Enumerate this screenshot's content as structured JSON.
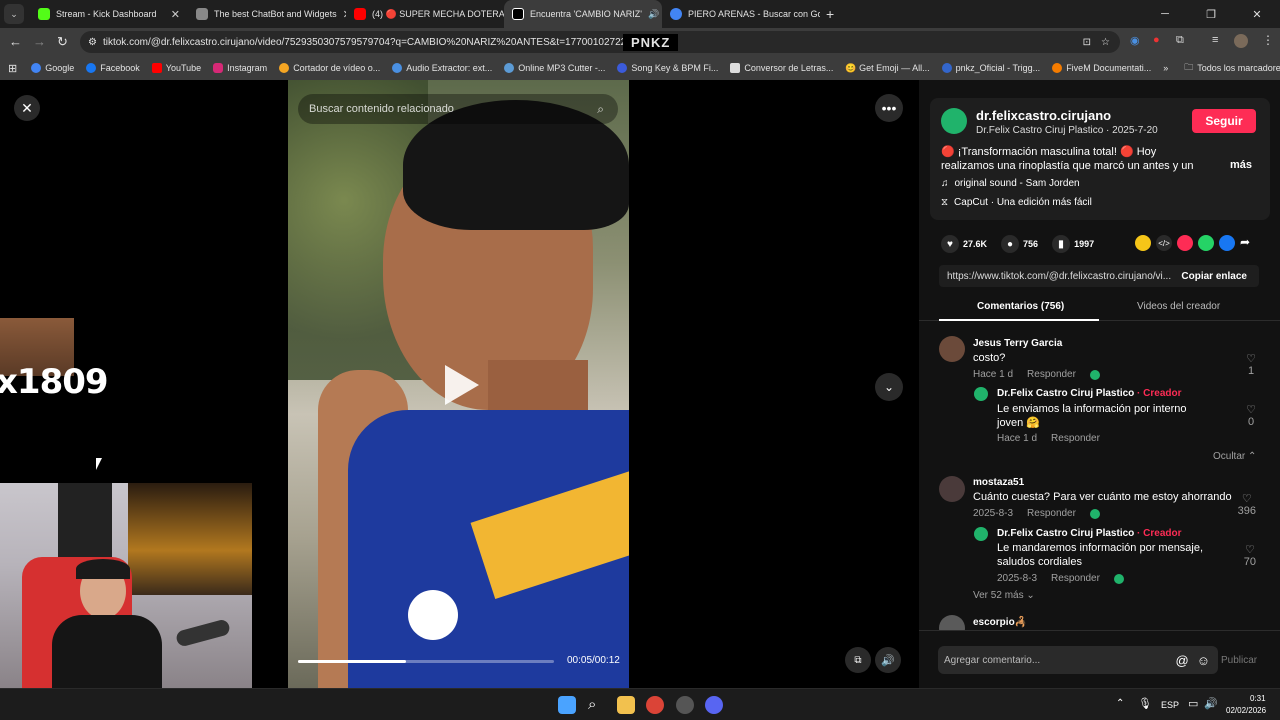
{
  "browser": {
    "tabs": [
      {
        "label": "Stream - Kick Dashboard",
        "color": "#53fc18"
      },
      {
        "label": "The best ChatBot and Widgets",
        "color": "#888888"
      },
      {
        "label": "(4) 🔴 SUPER MECHA DOTERA 🔴",
        "color": "#ff0000"
      },
      {
        "label": "Encuentra 'CAMBIO NARIZ'",
        "color": "#ffffff"
      },
      {
        "label": "PIERO ARENAS - Buscar con Go",
        "color": "#4285f4"
      }
    ],
    "url": "tiktok.com/@dr.felixcastro.cirujano/video/7529350307579579704?q=CAMBIO%20NARIZ%20ANTES&t=1770010272241",
    "overlay_logo": "PNKZ",
    "bookmarks": [
      "Google",
      "Facebook",
      "YouTube",
      "Instagram",
      "Cortador de vídeo o...",
      "Audio Extractor: ext...",
      "Online MP3 Cutter -...",
      "Song Key & BPM Fi...",
      "Conversor de Letras...",
      "😊 Get Emoji — All...",
      "pnkz_Oficial - Trigg...",
      "FiveM Documentati..."
    ],
    "bookmarks_all": "Todos los marcadores"
  },
  "stream": {
    "overlay_number": "x1809"
  },
  "video": {
    "search_placeholder": "Buscar contenido relacionado",
    "time": "00:05/00:12",
    "progress": 0.42
  },
  "panel": {
    "username": "dr.felixcastro.cirujano",
    "subtitle": "Dr.Felix Castro Ciruj Plastico · 2025-7-20",
    "follow_label": "Seguir",
    "description": "🔴 ¡Transformación masculina total! 🔴 Hoy realizamos una rinoplastía que marcó un antes y un después. Nuestro...",
    "more_label": "más",
    "sound": "original sound - Sam Jorden",
    "capcut": "CapCut · Una edición más fácil",
    "likes": "27.6K",
    "comments": "756",
    "saves": "1997",
    "link": "https://www.tiktok.com/@dr.felixcastro.cirujano/vi...",
    "copy_label": "Copiar enlace",
    "tab_comments": "Comentarios (756)",
    "tab_videos": "Videos del creador",
    "comment_list": [
      {
        "name": "Jesus Terry Garcia",
        "text": "costo?",
        "date": "Hace 1 d",
        "reply": "Responder",
        "likes": "1"
      },
      {
        "name": "Dr.Felix Castro Ciruj Plastico",
        "creator": "Creador",
        "text": "Le enviamos la información por interno joven 🤗",
        "date": "Hace 1 d",
        "reply": "Responder",
        "likes": "0"
      },
      {
        "name": "mostaza51",
        "text": "Cuánto cuesta? Para ver cuánto me estoy ahorrando",
        "date": "2025-8-3",
        "reply": "Responder",
        "likes": "396"
      },
      {
        "name": "Dr.Felix Castro Ciruj Plastico",
        "creator": "Creador",
        "text": "Le mandaremos información por mensaje, saludos cordiales",
        "date": "2025-8-3",
        "reply": "Responder",
        "likes": "70"
      },
      {
        "name": "escorpio🦂",
        "text": ""
      }
    ],
    "hide_label": "Ocultar",
    "see_more": "Ver 52 más",
    "add_comment_placeholder": "Agregar comentario...",
    "publish_label": "Publicar"
  },
  "taskbar": {
    "lang": "ESP",
    "time": "0:31",
    "date": "02/02/2026"
  }
}
